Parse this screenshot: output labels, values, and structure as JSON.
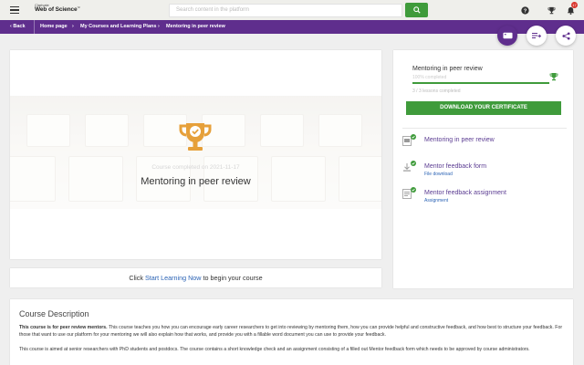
{
  "header": {
    "logo_line1": "Clarivate",
    "logo_line2": "Web of Science",
    "logo_tm": "™",
    "search_placeholder": "Search content in the platform",
    "notification_count": "17",
    "icons": [
      "menu-icon",
      "search-icon",
      "help-icon",
      "trophy-icon",
      "bell-icon"
    ]
  },
  "breadcrumb": {
    "back": "Back",
    "items": [
      "Home page",
      "My Courses and Learning Plans",
      "Mentoring in peer review"
    ]
  },
  "hero": {
    "completed_text": "Course completed on 2021-11-17",
    "title": "Mentoring in peer review"
  },
  "start": {
    "prefix": "Click",
    "link": "Start Learning Now",
    "suffix": "to begin your course"
  },
  "sidebar": {
    "course_title": "Mentoring in peer review",
    "progress_text": "100% completed",
    "progress_value": 1.0,
    "lessons_text": "3 / 3 lessons completed",
    "download_button": "DOWNLOAD YOUR CERTIFICATE",
    "lessons": [
      {
        "name": "Mentoring in peer review",
        "sub": "",
        "icon": "video-icon"
      },
      {
        "name": "Mentor feedback form",
        "sub": "File download",
        "icon": "download-icon"
      },
      {
        "name": "Mentor feedback assignment",
        "sub": "Assignment",
        "icon": "assignment-icon"
      }
    ]
  },
  "description": {
    "heading": "Course Description",
    "p1_bold": "This course is for peer review mentors.",
    "p1_rest": " This course teaches you how you can encourage early career researchers to get into reviewing by mentoring them, how you can provide helpful and constructive feedback, and how best to structure your feedback. For those that want to use our platform for your mentoring we will also explain how that works, and provide you with a fillable word document you can use to provide your feedback.",
    "p2": "This course is aimed at senior researchers with PhD students and postdocs. The course contains a short knowledge check and an assignment consisting of a filled out Mentor feedback form which needs to be approved by course administrators."
  },
  "colors": {
    "brand_purple": "#5f2e8d",
    "accent_green": "#3f9b3b",
    "trophy_gold": "#e6a03a",
    "link_blue": "#2b63b5"
  }
}
